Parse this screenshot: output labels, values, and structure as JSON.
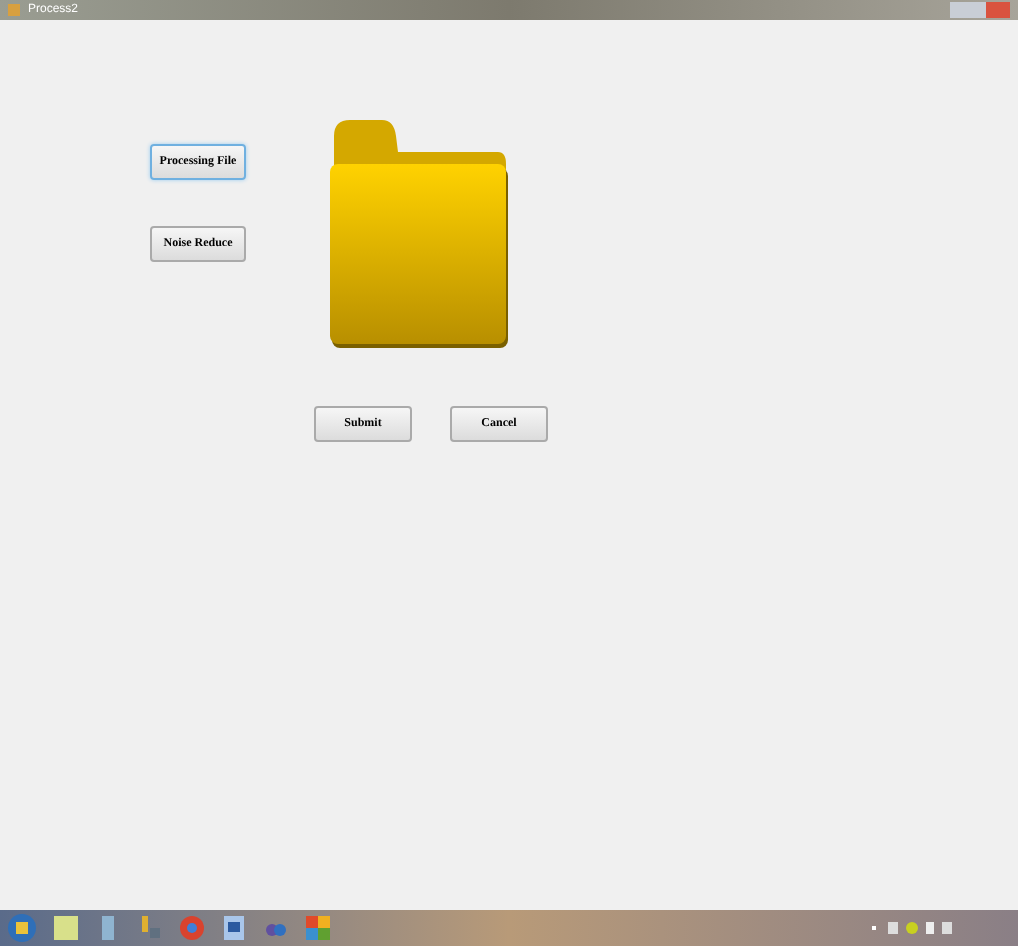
{
  "window": {
    "title": "Process2"
  },
  "side_buttons": [
    {
      "label": "Processing File",
      "focused": true
    },
    {
      "label": "Noise Reduce",
      "focused": false
    }
  ],
  "action_buttons": [
    {
      "label": "Submit"
    },
    {
      "label": "Cancel"
    }
  ]
}
